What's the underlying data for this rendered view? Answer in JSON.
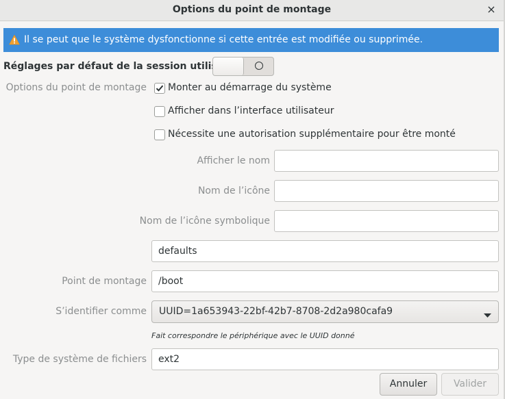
{
  "window": {
    "title": "Options du point de montage",
    "close_glyph": "×"
  },
  "warning": {
    "icon": "warning-icon",
    "text": "Il se peut que le système dysfonctionne si cette entrée est modifiée ou supprimée.",
    "color": "#3d8dd9"
  },
  "session_defaults": {
    "label": "Réglages par défaut de la session utilisateur",
    "toggle_state": "off"
  },
  "mount_options": {
    "section_label": "Options du point de montage",
    "checkboxes": [
      {
        "label": "Monter au démarrage du système",
        "checked": true
      },
      {
        "label": "Afficher dans l’interface utilisateur",
        "checked": false
      },
      {
        "label": "Nécessite une autorisation supplémentaire pour être monté",
        "checked": false
      }
    ]
  },
  "fields": {
    "display_name": {
      "label": "Afficher le nom",
      "value": ""
    },
    "icon_name": {
      "label": "Nom de l’icône",
      "value": ""
    },
    "symbolic_icon_name": {
      "label": "Nom de l’icône symbolique",
      "value": ""
    },
    "options": {
      "value": "defaults"
    },
    "mount_point": {
      "label": "Point de montage",
      "value": "/boot"
    },
    "identify_as": {
      "label": "S’identifier comme",
      "value": "UUID=1a653943-22bf-42b7-8708-2d2a980cafa9",
      "hint": "Fait correspondre le périphérique avec le UUID donné"
    },
    "fs_type": {
      "label": "Type de système de fichiers",
      "value": "ext2"
    }
  },
  "buttons": {
    "cancel": "Annuler",
    "ok": "Valider"
  }
}
